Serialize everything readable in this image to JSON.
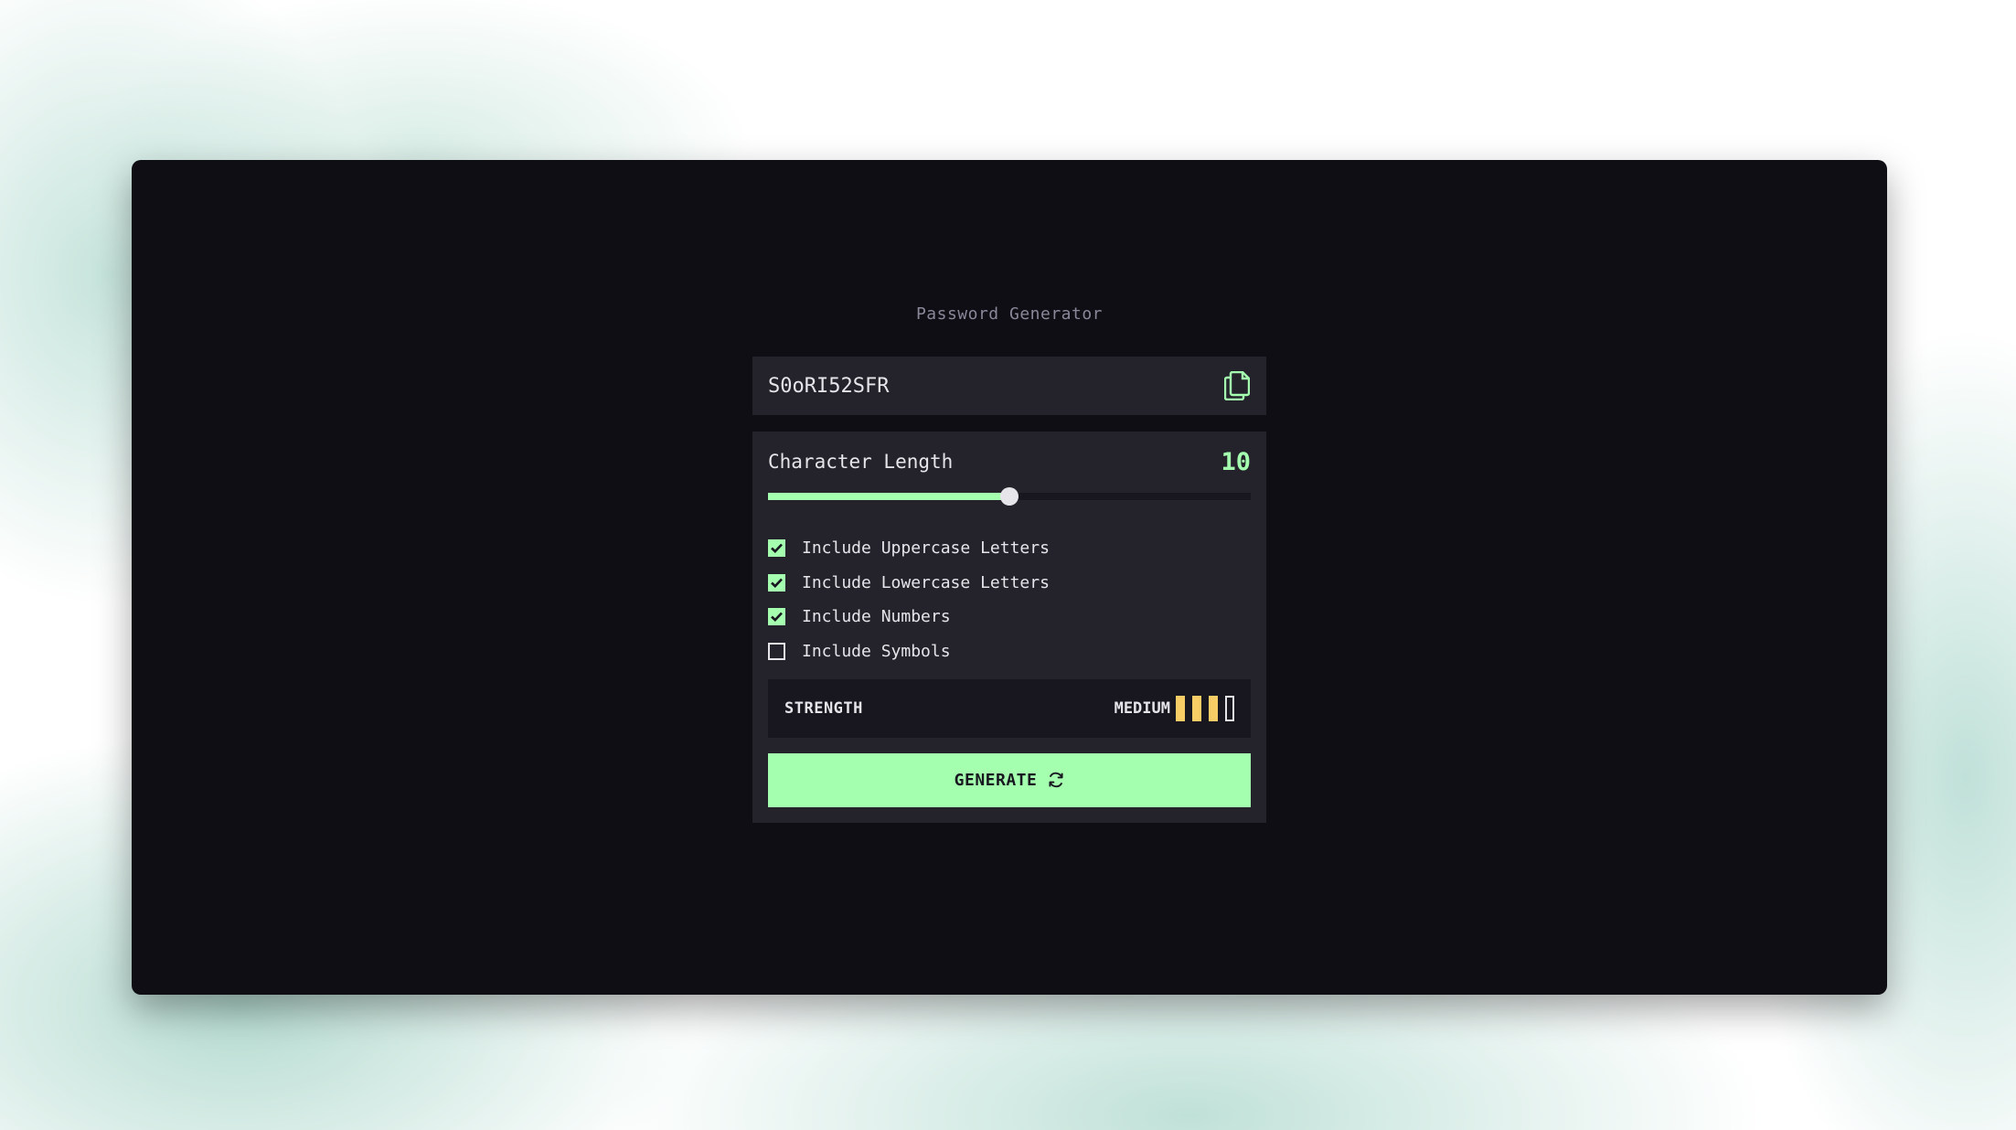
{
  "app": {
    "title": "Password Generator",
    "password": "S0oRI52SFR"
  },
  "length": {
    "label": "Character Length",
    "value": "10",
    "slider_fraction": 0.5
  },
  "options": [
    {
      "label": "Include Uppercase Letters",
      "checked": true
    },
    {
      "label": "Include Lowercase Letters",
      "checked": true
    },
    {
      "label": "Include Numbers",
      "checked": true
    },
    {
      "label": "Include Symbols",
      "checked": false
    }
  ],
  "strength": {
    "label": "STRENGTH",
    "value": "MEDIUM",
    "level": 3,
    "max_level": 4
  },
  "generate": {
    "label": "GENERATE"
  },
  "colors": {
    "accent": "#a4ffaf",
    "strength_medium": "#f8cd65",
    "panel_bg": "#0f0e14",
    "card_bg": "#24232c"
  },
  "icons": {
    "copy": "copy-icon",
    "generate": "refresh-icon",
    "check": "check-icon"
  }
}
